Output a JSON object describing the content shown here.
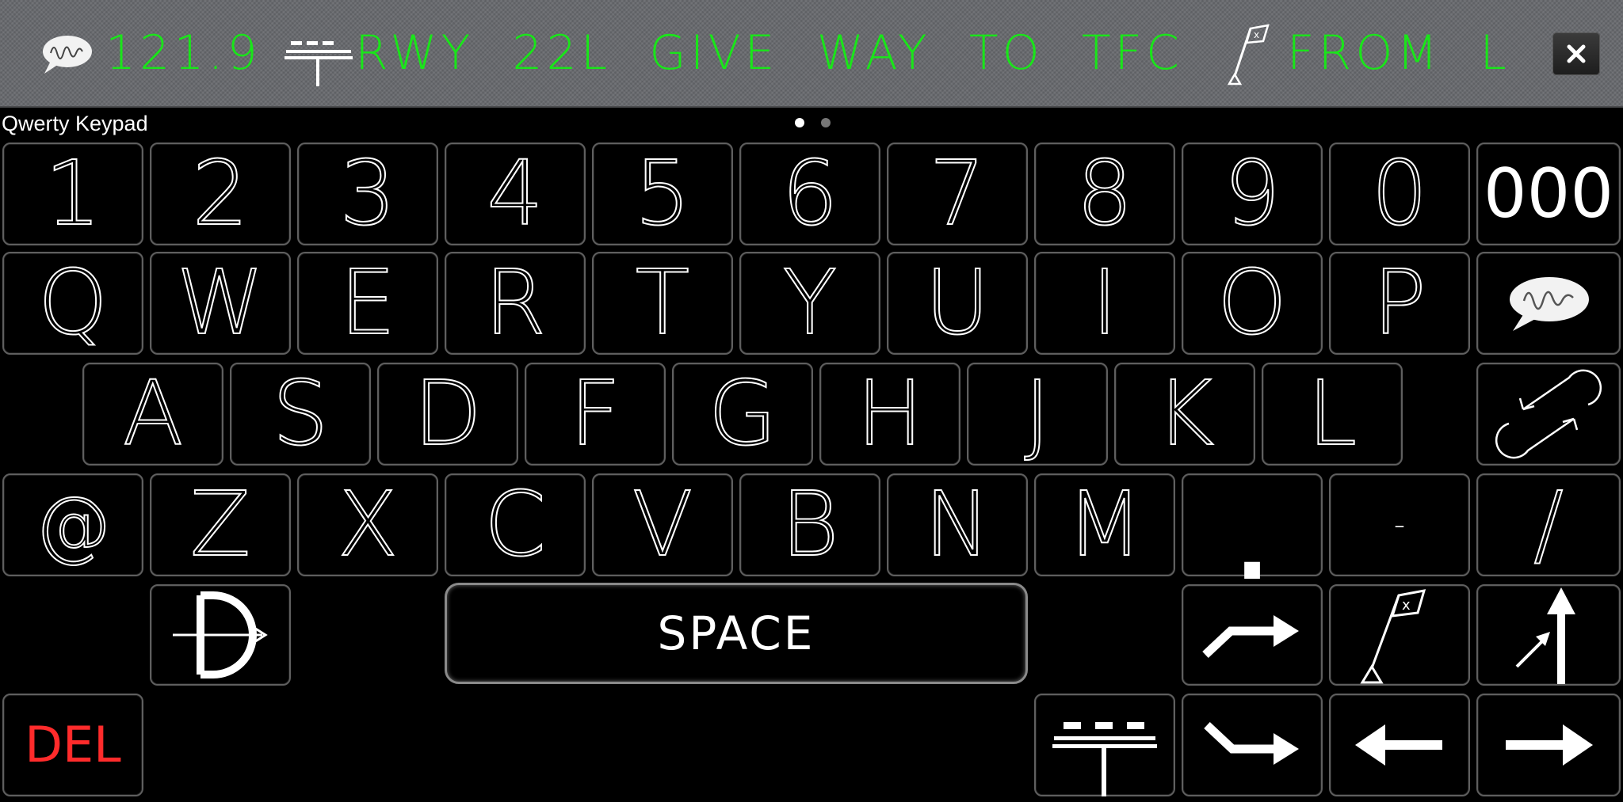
{
  "topbar": {
    "frequency": "121.9",
    "message": "RWY  22L  GIVE  WAY  TO  TFC",
    "from_text": "FROM  L",
    "icons": {
      "radio": "speech-bubble-radio-icon",
      "runway": "runway-lights-icon",
      "flag": "holding-point-flag-icon",
      "close": "close-icon"
    },
    "text_color": "#19e619"
  },
  "keyboard": {
    "title": "Qwerty Keypad",
    "page_indicator": {
      "pages": 2,
      "current": 1
    },
    "row1": [
      "1",
      "2",
      "3",
      "4",
      "5",
      "6",
      "7",
      "8",
      "9",
      "0",
      "000"
    ],
    "row2": [
      "Q",
      "W",
      "E",
      "R",
      "T",
      "Y",
      "U",
      "I",
      "O",
      "P"
    ],
    "row3": [
      "A",
      "S",
      "D",
      "F",
      "G",
      "H",
      "J",
      "K",
      "L"
    ],
    "row4": [
      "@",
      "Z",
      "X",
      "C",
      "V",
      "B",
      "N",
      "M",
      ".",
      "-",
      "/"
    ],
    "space_label": "SPACE",
    "del_label": "DEL",
    "del_color": "#ff2b2b",
    "special_keys": {
      "radio": "speech-bubble-radio-icon",
      "swap": "swap-arrows-icon",
      "direct_to": "direct-to-icon",
      "turn_right": "turn-right-arrow-icon",
      "holding_point": "holding-point-flag-icon",
      "straight_ahead": "straight-ahead-arrow-icon",
      "runway": "runway-lights-icon",
      "turn_down_right": "turn-down-right-arrow-icon",
      "arrow_left": "arrow-left-icon",
      "arrow_right": "arrow-right-icon"
    }
  }
}
